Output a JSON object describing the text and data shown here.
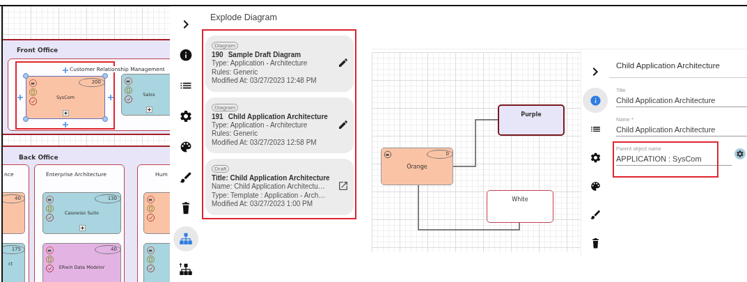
{
  "left_screen": {
    "canvas": {
      "lanes": [
        {
          "title": "Front Office"
        },
        {
          "title": "Back Office"
        }
      ],
      "containers": [
        {
          "title": "Customer Relationship Management"
        },
        {
          "title": "nce"
        },
        {
          "title": "Enterprise Architecture"
        },
        {
          "title": "Hum"
        }
      ],
      "nodes": [
        {
          "label": "SysCom",
          "badge": "200",
          "color": "#fbc3a5",
          "kind": "full",
          "expandable": true,
          "selected": true
        },
        {
          "label": "Sales",
          "color": "#a8d5df",
          "kind": "full",
          "expandable": true,
          "selected": false
        },
        {
          "badge": "40",
          "color": "#fbc3a5",
          "kind": "bare",
          "selected": false
        },
        {
          "label": "ct",
          "badge": "175",
          "color": "#a8d5df",
          "kind": "bare",
          "selected": false
        },
        {
          "label": "Casewise Suite",
          "badge": "130",
          "color": "#a8d5df",
          "kind": "full",
          "expandable": true,
          "selected": false
        },
        {
          "label": "ERwin Data Modeler",
          "badge": "40",
          "color": "#e3b3e3",
          "kind": "full",
          "selected": false
        },
        {
          "color": "#fbc3a5",
          "kind": "full",
          "selected": false
        },
        {
          "color": "#a8d5df",
          "kind": "full",
          "selected": false
        }
      ]
    },
    "sidebar": {
      "items": [
        {
          "kind": "collapse",
          "selected": false
        },
        {
          "kind": "info",
          "selected": false
        },
        {
          "kind": "list",
          "selected": false
        },
        {
          "kind": "settings",
          "selected": false
        },
        {
          "kind": "palette",
          "selected": false
        },
        {
          "kind": "brush",
          "selected": false
        },
        {
          "kind": "delete",
          "selected": false
        },
        {
          "kind": "hierarchy",
          "selected": true
        },
        {
          "kind": "hierarchy_up",
          "selected": false
        }
      ]
    },
    "panel": {
      "title": "Explode Diagram",
      "cards": [
        {
          "tag": "Diagram",
          "number": "190",
          "title": "Sample Draft Diagram",
          "details": [
            "Type: Application - Architecture",
            "Rules: Generic",
            "Modified At: 03/27/2023 12:48 PM"
          ],
          "kind": "edit"
        },
        {
          "tag": "Diagram",
          "number": "191",
          "title": "Child Application Architecture",
          "details": [
            "Type: Application - Architecture",
            "Rules: Generic",
            "Modified At: 03/27/2023 12:58 PM"
          ],
          "kind": "edit"
        },
        {
          "tag": "Draft",
          "title": "Title: Child Application Architecture",
          "details": [
            "Name: Child Application Architectu…",
            "Type: Template : Application - Arch…",
            "Modified At: 03/27/2023 1:00 PM"
          ],
          "kind": "open"
        }
      ]
    }
  },
  "right_screen": {
    "canvas": {
      "nodes": [
        {
          "kind": "box",
          "label": "Purple",
          "color": "#e6e6f8",
          "selected": true
        },
        {
          "kind": "application",
          "label": "Orange",
          "badge": "0",
          "color": "#fbc3a5",
          "selected": false
        },
        {
          "kind": "box",
          "label": "White",
          "color": "#ffffff",
          "selected": false
        }
      ]
    },
    "sidebar": {
      "items": [
        {
          "kind": "collapse",
          "selected": false
        },
        {
          "kind": "info",
          "selected": true
        },
        {
          "kind": "list",
          "selected": false
        },
        {
          "kind": "settings",
          "selected": false
        },
        {
          "kind": "palette",
          "selected": false
        },
        {
          "kind": "brush",
          "selected": false
        },
        {
          "kind": "delete",
          "selected": false
        }
      ]
    },
    "panel": {
      "title": "Child Application Architecture",
      "fields": [
        {
          "kind": "text",
          "label": "Title",
          "value": "Child Application Architecture",
          "highlighted": false
        },
        {
          "kind": "text",
          "label": "Name *",
          "value": "Child Application Architecture",
          "highlighted": false
        },
        {
          "kind": "lookup",
          "label": "Parent object name",
          "value": "APPLICATION : SysCom",
          "highlighted": true
        }
      ]
    }
  }
}
